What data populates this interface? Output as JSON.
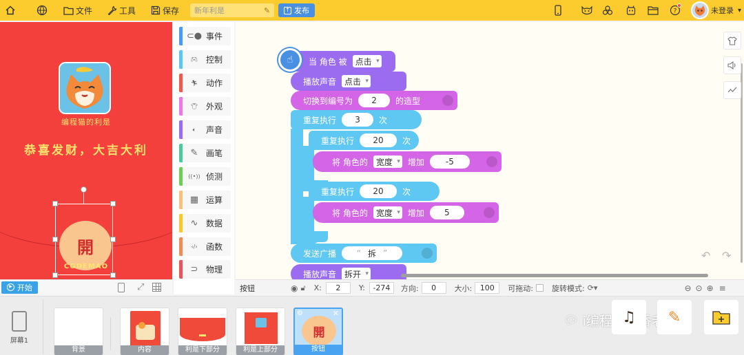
{
  "topbar": {
    "file_label": "文件",
    "tools_label": "工具",
    "save_label": "保存",
    "project_title": "新年利是",
    "publish_label": "发布",
    "login_label": "未登录"
  },
  "stage": {
    "subtitle": "编程猫的利是",
    "greeting": "恭喜发财，大吉大利",
    "badge_char": "開",
    "logo_text": "CODEMAO",
    "start_label": "开始"
  },
  "palette": {
    "categories": [
      {
        "label": "事件",
        "icon": "toggle-icon",
        "color": "#4a9bef"
      },
      {
        "label": "控制",
        "icon": "gamepad-icon",
        "color": "#5cc8f2"
      },
      {
        "label": "动作",
        "icon": "running-icon",
        "color": "#ef5a4d"
      },
      {
        "label": "外观",
        "icon": "shirt-icon",
        "color": "#f076e4"
      },
      {
        "label": "声音",
        "icon": "speaker-icon",
        "color": "#9b6bf0"
      },
      {
        "label": "画笔",
        "icon": "pen-icon",
        "color": "#49c9a0"
      },
      {
        "label": "侦测",
        "icon": "signal-icon",
        "color": "#6bcf56"
      },
      {
        "label": "运算",
        "icon": "calculator-icon",
        "color": "#f6c27a"
      },
      {
        "label": "数据",
        "icon": "chart-line-icon",
        "color": "#fcc72c"
      },
      {
        "label": "函数",
        "icon": "code-icon",
        "color": "#f18c57"
      },
      {
        "label": "物理",
        "icon": "magnet-icon",
        "color": "#e7565e"
      }
    ]
  },
  "script": {
    "hat_text": "当 角色 被",
    "hat_option": "点击",
    "play_sound_1": "播放声音",
    "sound_1": "点击",
    "switch_costume_pre": "切换到编号为",
    "costume_num": "2",
    "switch_costume_post": "的造型",
    "repeat_outer": "重复执行",
    "repeat_outer_times": "3",
    "times_word": "次",
    "repeat_inner_1": "重复执行",
    "repeat_inner_1_times": "20",
    "change_1_pre": "将 角色的",
    "change_1_prop": "宽度",
    "change_1_mid": "增加",
    "change_1_val": "-5",
    "repeat_inner_2": "重复执行",
    "repeat_inner_2_times": "20",
    "change_2_pre": "将 角色的",
    "change_2_prop": "宽度",
    "change_2_mid": "增加",
    "change_2_val": "5",
    "broadcast": "发送广播",
    "broadcast_msg": "拆",
    "play_sound_2": "播放声音",
    "sound_2": "拆开"
  },
  "props": {
    "sprite_name": "按钮",
    "x_label": "X:",
    "x_value": "2",
    "y_label": "Y:",
    "y_value": "-274",
    "dir_label": "方向:",
    "dir_value": "0",
    "size_label": "大小:",
    "size_value": "100",
    "drag_label": "可拖动:",
    "rotate_label": "旋转模式:"
  },
  "tray": {
    "screen_label": "屏幕1",
    "sprites": [
      "背景",
      "内容",
      "利是下部分",
      "利是上部分",
      "按钮"
    ]
  },
  "watermark": "i编程的香香老师"
}
